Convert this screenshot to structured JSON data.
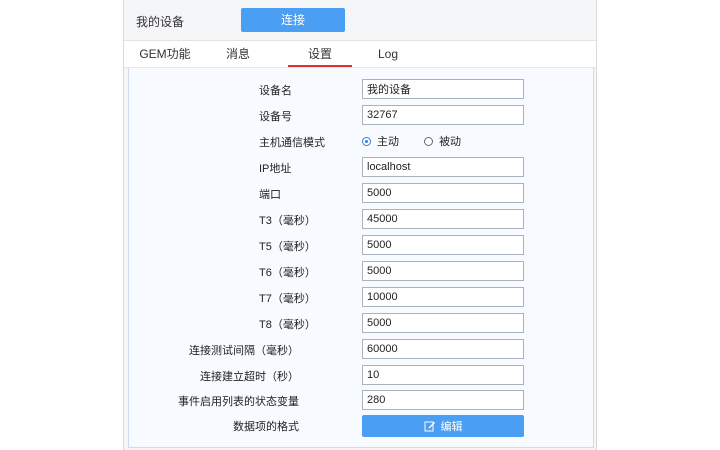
{
  "header": {
    "device_title": "我的设备",
    "connect_label": "连接"
  },
  "tabs": [
    {
      "label": "GEM功能"
    },
    {
      "label": "消息"
    },
    {
      "label": "设置",
      "active": true
    },
    {
      "label": "Log"
    }
  ],
  "form": {
    "device_name": {
      "label": "设备名",
      "value": "我的设备"
    },
    "device_id": {
      "label": "设备号",
      "value": "32767"
    },
    "comm_mode": {
      "label": "主机通信模式",
      "options": [
        "主动",
        "被动"
      ],
      "selected": "主动"
    },
    "ip": {
      "label": "IP地址",
      "value": "localhost"
    },
    "port": {
      "label": "端口",
      "value": "5000"
    },
    "t3": {
      "label": "T3（毫秒）",
      "value": "45000"
    },
    "t5": {
      "label": "T5（毫秒）",
      "value": "5000"
    },
    "t6": {
      "label": "T6（毫秒）",
      "value": "5000"
    },
    "t7": {
      "label": "T7（毫秒）",
      "value": "10000"
    },
    "t8": {
      "label": "T8（毫秒）",
      "value": "5000"
    },
    "link_test": {
      "label": "连接测试间隔（毫秒）",
      "value": "60000"
    },
    "connect_timeout": {
      "label": "连接建立超时（秒）",
      "value": "10"
    },
    "event_status_var": {
      "label": "事件启用列表的状态变量",
      "value": "280"
    },
    "data_format": {
      "label": "数据项的格式",
      "button_label": "编辑"
    }
  },
  "icons": {
    "edit": "edit-icon"
  },
  "colors": {
    "primary": "#4a9ff5",
    "active_tab": "#e0332f"
  }
}
